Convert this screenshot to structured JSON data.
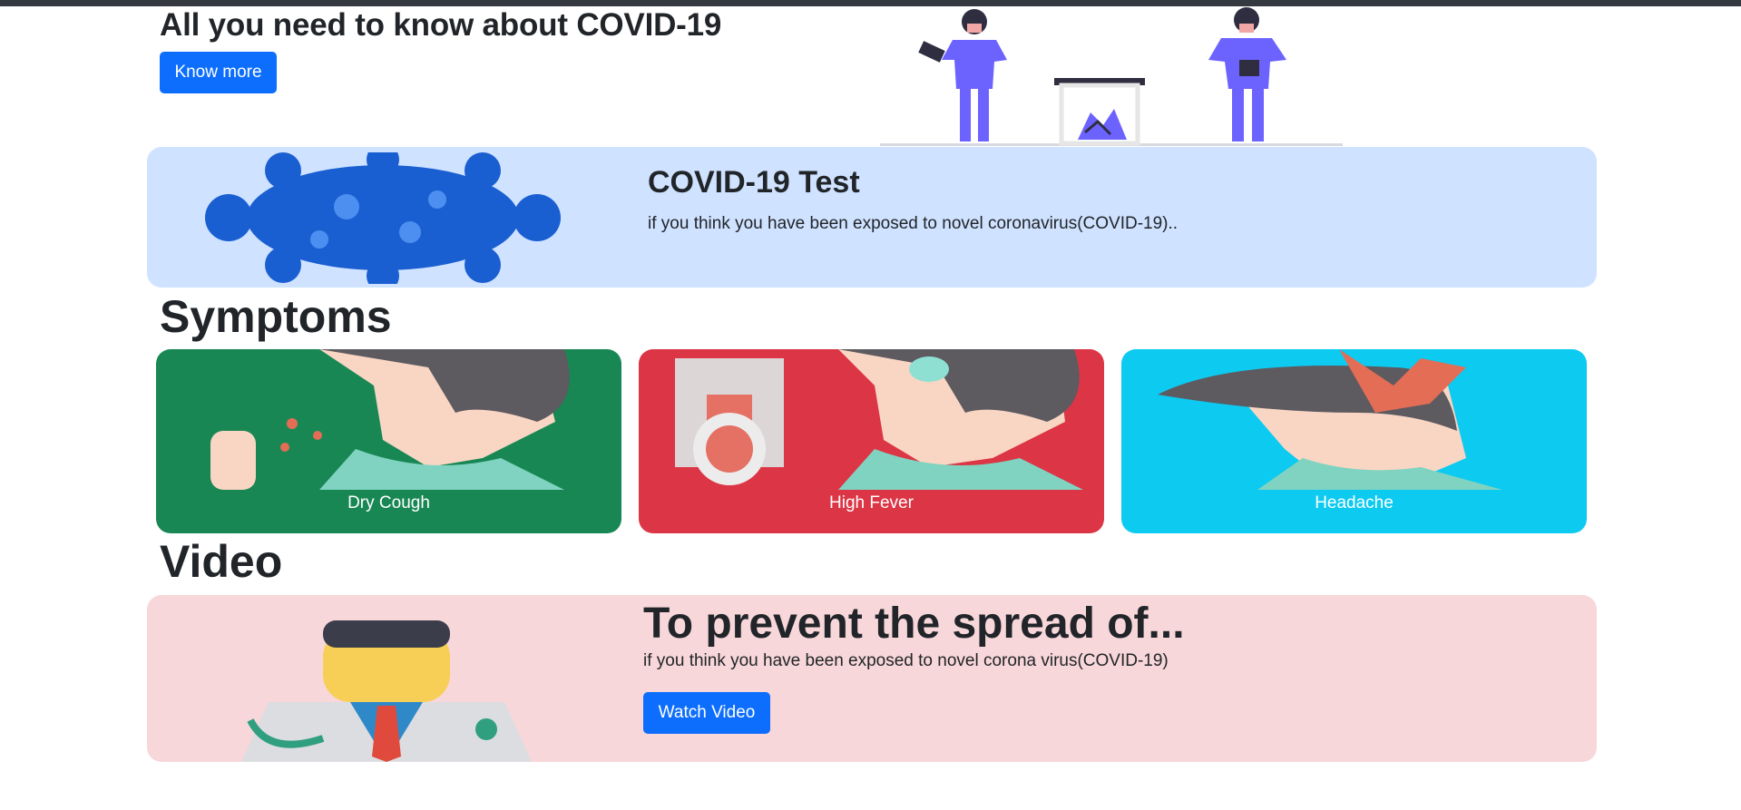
{
  "hero": {
    "title": "All you need to know about COVID-19",
    "button_label": "Know more"
  },
  "test_banner": {
    "title": "COVID-19 Test",
    "text": "if you think you have been exposed to novel coronavirus(COVID-19).."
  },
  "symptoms": {
    "heading": "Symptoms",
    "cards": [
      {
        "label": "Dry Cough",
        "color": "#198754"
      },
      {
        "label": "High Fever",
        "color": "#dc3545"
      },
      {
        "label": "Headache",
        "color": "#0dcaf0"
      }
    ]
  },
  "video": {
    "heading": "Video",
    "title": "To prevent the spread of...",
    "text": "if you think you have been exposed to novel corona virus(COVID-19)",
    "button_label": "Watch Video"
  },
  "colors": {
    "primary": "#0d6efd",
    "test_bg": "#cfe2ff",
    "video_bg": "#f8d7da",
    "topbar": "#343a40"
  }
}
